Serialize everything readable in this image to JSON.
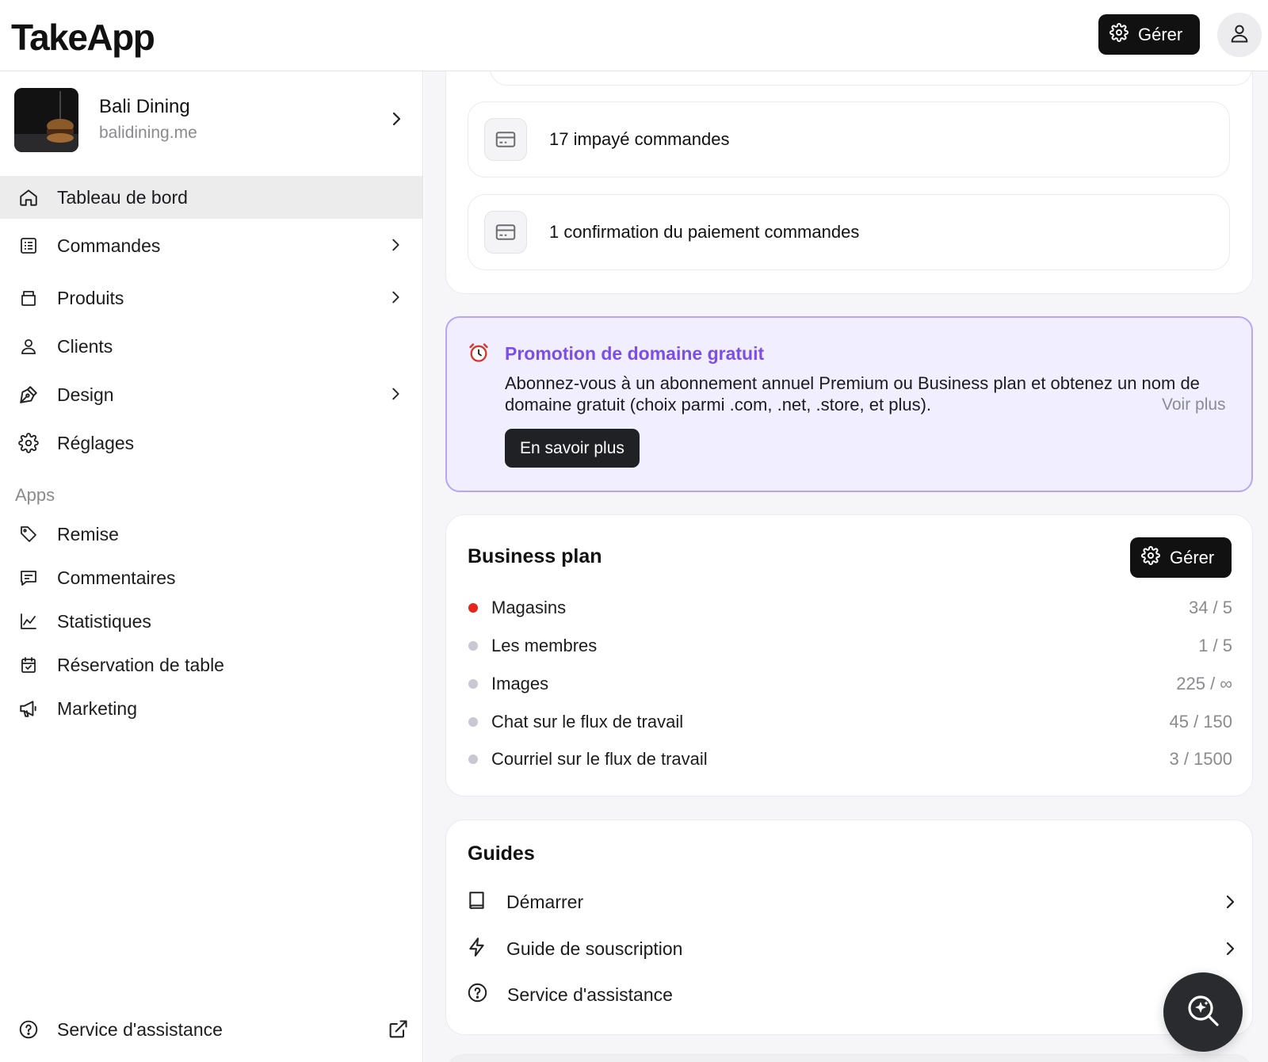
{
  "header": {
    "logo": "TakeApp",
    "manage_label": "Gérer"
  },
  "store": {
    "name": "Bali Dining",
    "domain": "balidining.me"
  },
  "nav": {
    "items": [
      {
        "label": "Tableau de bord",
        "icon": "home-icon"
      },
      {
        "label": "Commandes",
        "icon": "orders-icon"
      },
      {
        "label": "Produits",
        "icon": "products-icon"
      },
      {
        "label": "Clients",
        "icon": "user-icon"
      },
      {
        "label": "Design",
        "icon": "pen-icon"
      },
      {
        "label": "Réglages",
        "icon": "gear-icon"
      }
    ],
    "apps_title": "Apps",
    "apps": [
      {
        "label": "Remise",
        "icon": "tag-icon"
      },
      {
        "label": "Commentaires",
        "icon": "comment-icon"
      },
      {
        "label": "Statistiques",
        "icon": "chart-icon"
      },
      {
        "label": "Réservation de table",
        "icon": "calendar-icon"
      },
      {
        "label": "Marketing",
        "icon": "megaphone-icon"
      }
    ],
    "support": "Service d'assistance"
  },
  "orders": [
    {
      "text": "17 impayé commandes"
    },
    {
      "text": "1 confirmation du paiement commandes"
    }
  ],
  "promo": {
    "title": "Promotion de domaine gratuit",
    "text": "Abonnez-vous à un abonnement annuel Premium ou Business plan et obtenez un nom de domaine gratuit (choix parmi .com, .net, .store, et plus).",
    "more": "Voir plus",
    "button": "En savoir plus",
    "accent": "#7c4ee8"
  },
  "plan": {
    "title": "Business plan",
    "manage_label": "Gérer",
    "rows": [
      {
        "label": "Magasins",
        "value": "34 / 5",
        "over_limit": true
      },
      {
        "label": "Les membres",
        "value": "1 / 5",
        "over_limit": false
      },
      {
        "label": "Images",
        "value": "225 / ∞",
        "over_limit": false
      },
      {
        "label": "Chat sur le flux de travail",
        "value": "45 / 150",
        "over_limit": false
      },
      {
        "label": "Courriel sur le flux de travail",
        "value": "3 / 1500",
        "over_limit": false
      }
    ]
  },
  "guides": {
    "title": "Guides",
    "items": [
      {
        "label": "Démarrer",
        "icon": "book-icon"
      },
      {
        "label": "Guide de souscription",
        "icon": "bolt-icon"
      },
      {
        "label": "Service d'assistance",
        "icon": "help-circle-icon"
      }
    ]
  }
}
